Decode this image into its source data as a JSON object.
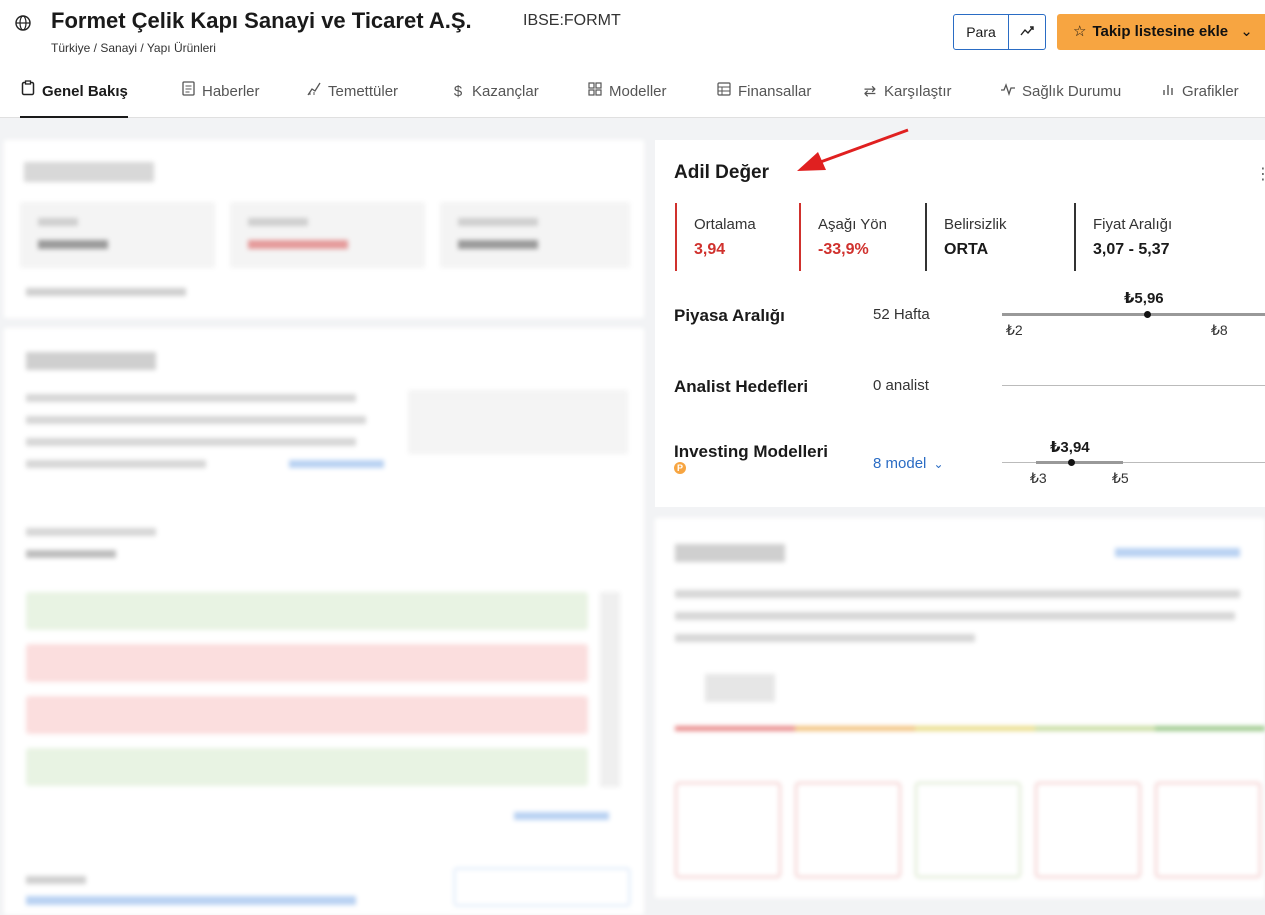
{
  "header": {
    "company_name": "Formet Çelik Kapı Sanayi ve Ticaret A.Ş.",
    "ticker": "IBSE:FORMT",
    "breadcrumb": "Türkiye / Sanayi / Yapı Ürünleri",
    "currency_button": "Para",
    "watchlist_button": "Takip listesine ekle"
  },
  "tabs": [
    {
      "label": "Genel Bakış",
      "icon": "clipboard-icon",
      "active": true
    },
    {
      "label": "Haberler",
      "icon": "document-icon"
    },
    {
      "label": "Temettüler",
      "icon": "growth-icon"
    },
    {
      "label": "Kazançlar",
      "icon": "dollar-icon"
    },
    {
      "label": "Modeller",
      "icon": "grid-icon"
    },
    {
      "label": "Finansallar",
      "icon": "table-icon"
    },
    {
      "label": "Karşılaştır",
      "icon": "swap-icon"
    },
    {
      "label": "Sağlık Durumu",
      "icon": "pulse-icon"
    },
    {
      "label": "Grafikler",
      "icon": "bar-chart-icon"
    }
  ],
  "fair_value": {
    "title": "Adil Değer",
    "stats": [
      {
        "label": "Ortalama",
        "value": "3,94",
        "color": "#d0312d"
      },
      {
        "label": "Aşağı Yön",
        "value": "-33,9%",
        "color": "#d0312d"
      },
      {
        "label": "Belirsizlik",
        "value": "ORTA",
        "color": "#1a1a1a"
      },
      {
        "label": "Fiyat Aralığı",
        "value": "3,07 - 5,37",
        "color": "#1a1a1a"
      }
    ],
    "market_range": {
      "label": "Piyasa Aralığı",
      "period": "52 Hafta",
      "current": "₺5,96",
      "low": "₺2",
      "high": "₺8",
      "current_fraction": 0.66
    },
    "analyst_targets": {
      "label": "Analist Hedefleri",
      "count": "0 analist"
    },
    "investing_models": {
      "label": "Investing Modelleri",
      "models_link": "8 model",
      "current": "₺3,94",
      "low": "₺3",
      "high": "₺5"
    }
  },
  "colors": {
    "accent_orange": "#f7a541",
    "accent_blue": "#2a6cc4",
    "negative_red": "#d0312d"
  }
}
